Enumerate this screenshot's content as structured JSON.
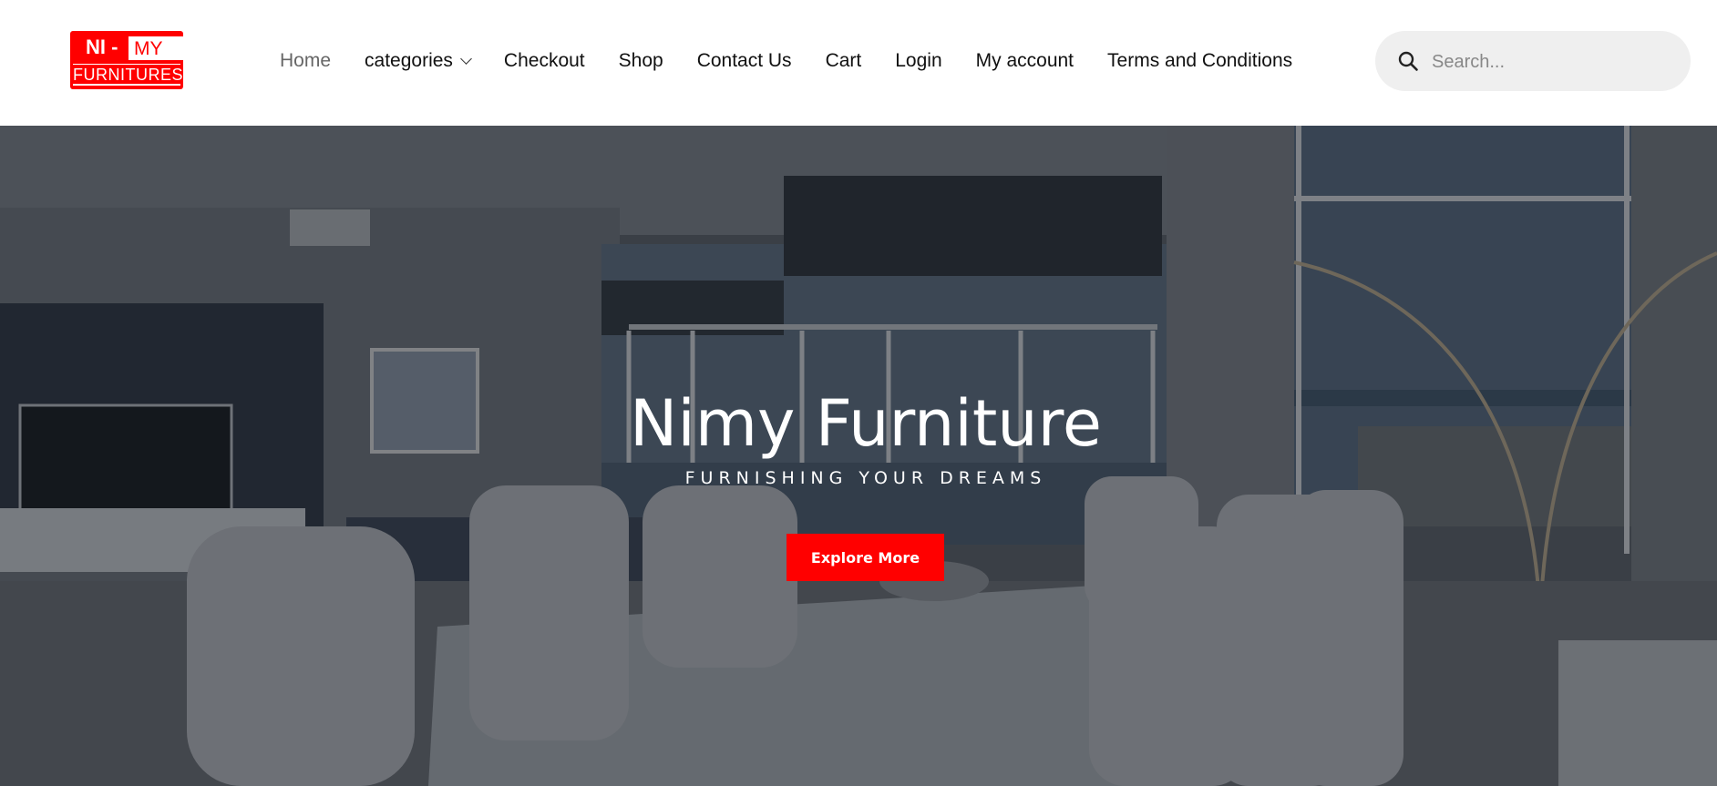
{
  "brand": {
    "logo_top_left": "NI -",
    "logo_top_right": "MY",
    "logo_bottom": "FURNITURES",
    "accent_color": "#ff0000"
  },
  "nav": {
    "items": [
      {
        "label": "Home",
        "active": true
      },
      {
        "label": "categories",
        "has_dropdown": true
      },
      {
        "label": "Checkout"
      },
      {
        "label": "Shop"
      },
      {
        "label": "Contact Us"
      },
      {
        "label": "Cart"
      },
      {
        "label": "Login"
      },
      {
        "label": "My account"
      },
      {
        "label": "Terms and Conditions"
      }
    ]
  },
  "search": {
    "placeholder": "Search...",
    "icon": "search-icon"
  },
  "hero": {
    "title": "Nimy Furniture",
    "subtitle": "FURNISHING YOUR DREAMS",
    "button_label": "Explore More",
    "button_color": "#ff0000",
    "background_image": "dining room with ocean view"
  }
}
